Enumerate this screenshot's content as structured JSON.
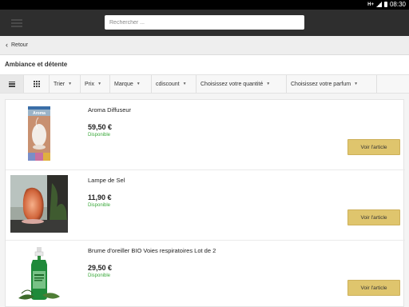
{
  "status": {
    "network": "H+",
    "time": "08:30"
  },
  "search": {
    "placeholder": "Rechercher ..."
  },
  "nav": {
    "back_label": "Retour"
  },
  "category": {
    "title": "Ambiance et détente"
  },
  "filters": [
    "Trier",
    "Prix",
    "Marque",
    "cdiscount",
    "Choisissez votre quantité",
    "Choisissez votre parfum"
  ],
  "products": [
    {
      "name": "Aroma Diffuseur",
      "price": "59,50 €",
      "availability": "Disponible",
      "button": "Voir l'article",
      "image_label": "Aroma"
    },
    {
      "name": "Lampe de Sel",
      "price": "11,90 €",
      "availability": "Disponible",
      "button": "Voir l'article"
    },
    {
      "name": "Brume d'oreiller BIO Voies respiratoires Lot de 2",
      "price": "29,50 €",
      "availability": "Disponible",
      "button": "Voir l'article"
    }
  ]
}
